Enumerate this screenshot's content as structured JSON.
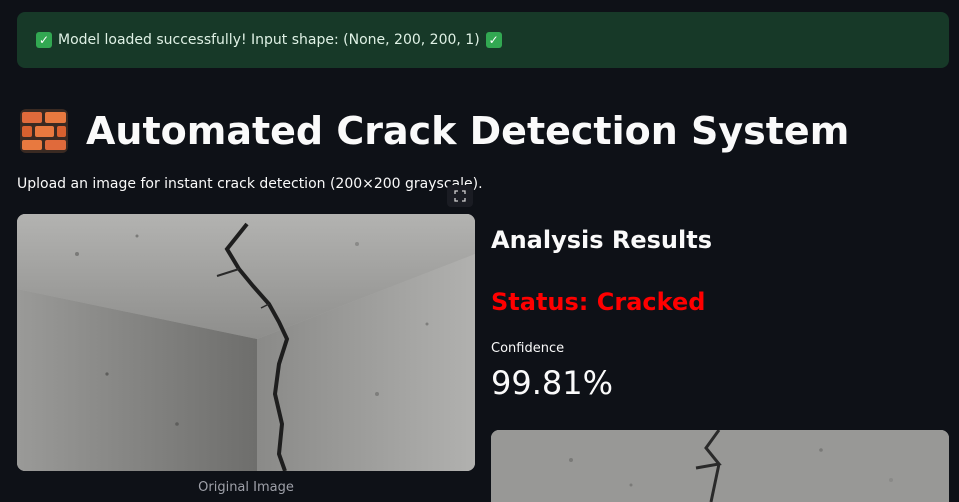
{
  "alert": {
    "text": "Model loaded successfully! Input shape: (None, 200, 200, 1)",
    "icon": "check-mark-icon",
    "color": "#173928"
  },
  "header": {
    "title": "Automated Crack Detection System",
    "icon": "brick-icon"
  },
  "subtitle": "Upload an image for instant crack detection (200×200 grayscale).",
  "original_image": {
    "caption": "Original Image"
  },
  "results": {
    "heading": "Analysis Results",
    "status": "Status: Cracked",
    "status_color": "#ff0000",
    "confidence_label": "Confidence",
    "confidence_value": "99.81%"
  },
  "colors": {
    "background": "#0e1117",
    "text": "#fafafa"
  }
}
